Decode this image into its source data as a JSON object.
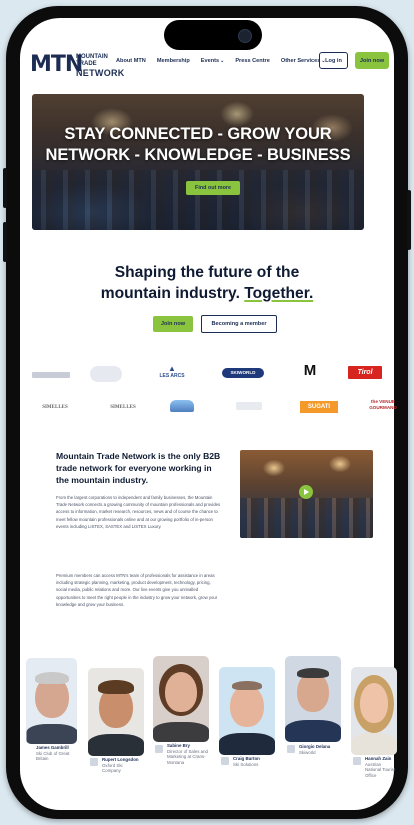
{
  "logo": {
    "mark": "MTN",
    "line1": "MOUNTAIN",
    "line2": "TRADE",
    "line3": "NETWORK"
  },
  "nav": {
    "links": [
      "About MTN",
      "Membership",
      "Events",
      "Press Centre",
      "Other Services"
    ],
    "login": "Log in",
    "join": "Join now"
  },
  "hero": {
    "title_line1": "STAY CONNECTED - GROW YOUR",
    "title_line2": "NETWORK - KNOWLEDGE - BUSINESS",
    "cta": "Find out more"
  },
  "tagline": {
    "line1": "Shaping the future of the",
    "line2_plain": "mountain industry. ",
    "line2_underlined": "Together.",
    "join": "Join now",
    "member": "Becoming a member"
  },
  "partners": {
    "row1": [
      "LES ARCS",
      "SKIWORLD",
      "M",
      "Tirol"
    ],
    "row2": [
      "SIMELLES",
      "SIMELLES",
      "SUGATI",
      "the VENUE GOURMAND"
    ]
  },
  "about": {
    "title": "Mountain Trade Network is the only B2B trade network for everyone working in the mountain industry.",
    "para1": "From the largest corporations to independent and family businesses, the Mountain Trade Network connects a growing community of mountain professionals and provides access to information, market research, resources, news and of course the chance to meet fellow mountain professionals online and at our growing portfolio of in-person events including LISTEX, SASTEX and LISTEX Luxury.",
    "para2": "Premium members can access MTN's team of professionals for assistance in areas including strategic planning, marketing, product development, technology, pricing, social media, public relations and more. Our live events give you unrivalled opportunities to meet the right people in the industry to grow your network, grow your knowledge and grow your business."
  },
  "team": [
    {
      "name": "James Gambrill",
      "role": "Ski Club of Great Britain"
    },
    {
      "name": "Rupert Longsdon",
      "role": "Oxford Ski Company"
    },
    {
      "name": "Sabine Bry",
      "role": "Director of Sales and Marketing at Crans-Montana"
    },
    {
      "name": "Craig Burton",
      "role": "Ski Solutions"
    },
    {
      "name": "Giorgio Delana",
      "role": "Skiworld"
    },
    {
      "name": "Hannah Zain",
      "role": "Austrian National Tourist Office"
    }
  ],
  "colors": {
    "accent": "#8ac43f",
    "navy": "#1c2d54"
  }
}
